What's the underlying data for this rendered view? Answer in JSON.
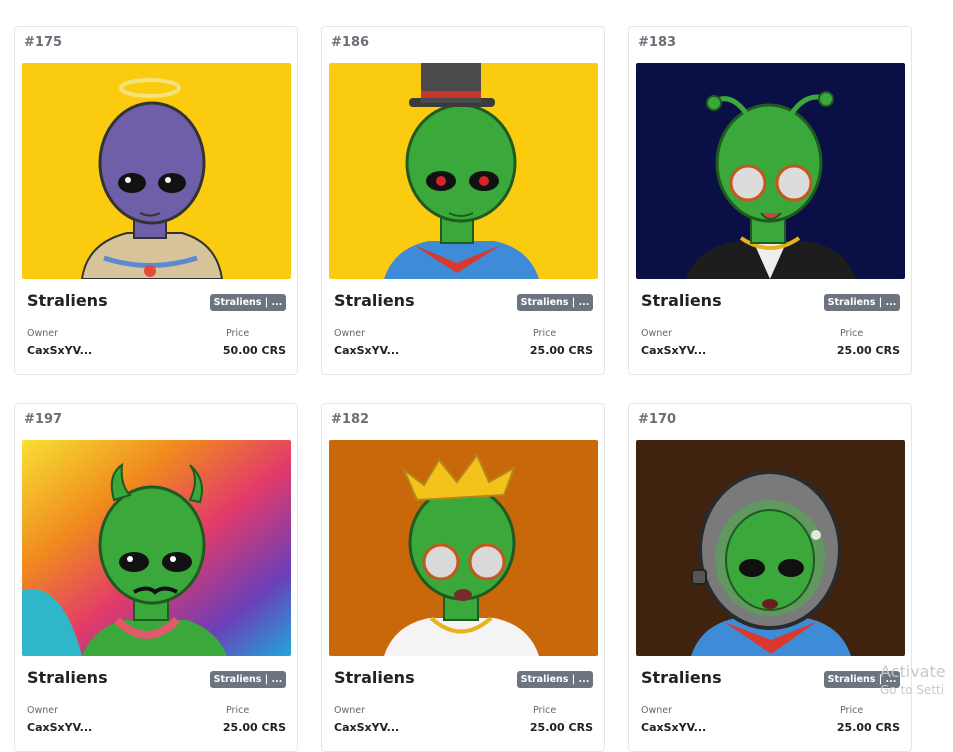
{
  "cards": [
    {
      "number": "#175",
      "name": "Straliens",
      "badge": "Straliens | ...",
      "owner_label": "Owner",
      "owner": "CaxSxYV...",
      "price_label": "Price",
      "price": "50.00 CRS",
      "bg": "#fbcb0f",
      "skin": "#6f5ea8",
      "accessory": "halo-icon"
    },
    {
      "number": "#186",
      "name": "Straliens",
      "badge": "Straliens | ...",
      "owner_label": "Owner",
      "owner": "CaxSxYV...",
      "price_label": "Price",
      "price": "25.00 CRS",
      "bg": "#fbcb0f",
      "skin": "#3aa83a",
      "accessory": "top-hat-icon"
    },
    {
      "number": "#183",
      "name": "Straliens",
      "badge": "Straliens | ...",
      "owner_label": "Owner",
      "owner": "CaxSxYV...",
      "price_label": "Price",
      "price": "25.00 CRS",
      "bg": "#0a0f45",
      "skin": "#3aa83a",
      "accessory": "antennae-icon"
    },
    {
      "number": "#197",
      "name": "Straliens",
      "badge": "Straliens | ...",
      "owner_label": "Owner",
      "owner": "CaxSxYV...",
      "price_label": "Price",
      "price": "25.00 CRS",
      "bg": "#e86f1d",
      "skin": "#3aa83a",
      "accessory": "devil-horns-icon"
    },
    {
      "number": "#182",
      "name": "Straliens",
      "badge": "Straliens | ...",
      "owner_label": "Owner",
      "owner": "CaxSxYV...",
      "price_label": "Price",
      "price": "25.00 CRS",
      "bg": "#c8680a",
      "skin": "#3aa83a",
      "accessory": "crown-icon"
    },
    {
      "number": "#170",
      "name": "Straliens",
      "badge": "Straliens | ...",
      "owner_label": "Owner",
      "owner": "CaxSxYV...",
      "price_label": "Price",
      "price": "25.00 CRS",
      "bg": "#40230e",
      "skin": "#3aa83a",
      "accessory": "space-helmet-icon"
    }
  ],
  "watermark": {
    "line1": "Activate",
    "line2": "Go to Setti"
  }
}
